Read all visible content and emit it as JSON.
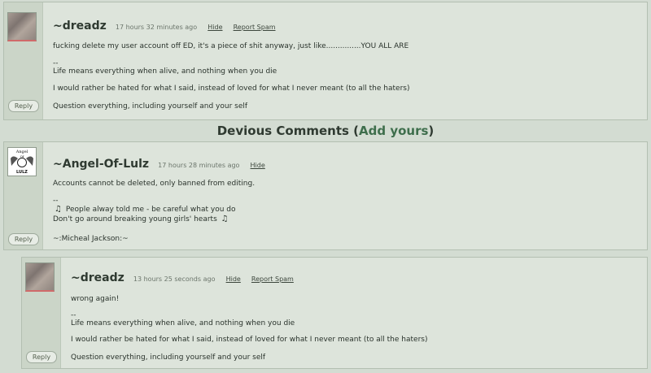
{
  "comment1": {
    "username": "~dreadz",
    "timestamp": "17 hours 32 minutes ago",
    "hide": "Hide",
    "report": "Report Spam",
    "text": "fucking delete my user account off ED, it's a piece of shit anyway, just like...............YOU ALL ARE",
    "sig_sep": "--",
    "sig_line1": "Life means everything when alive, and nothing when you die",
    "sig_line2": "I would rather be hated for what I said, instead of loved for what I never meant (to all the haters)",
    "sig_line3": "Question everything, including yourself and your self",
    "reply": "Reply"
  },
  "section": {
    "title": "Devious Comments",
    "open_paren": "(",
    "add": "Add yours",
    "close_paren": ")"
  },
  "comment2": {
    "username": "~Angel-Of-Lulz",
    "timestamp": "17 hours 28 minutes ago",
    "hide": "Hide",
    "text": "Accounts cannot be deleted, only banned from editing.",
    "sig_sep": "--",
    "sig_line1": "People alway told me - be careful what you do",
    "sig_line2": "Don't go around breaking young girls' hearts",
    "sig_line3": "~:Micheal Jackson:~",
    "note_icon": "♫",
    "avatar_top": "Angel",
    "avatar_mid": "Of",
    "avatar_bottom": "LULZ",
    "reply": "Reply"
  },
  "comment3": {
    "username": "~dreadz",
    "timestamp": "13 hours 25 seconds ago",
    "hide": "Hide",
    "report": "Report Spam",
    "text": "wrong again!",
    "sig_sep": "--",
    "sig_line1": "Life means everything when alive, and nothing when you die",
    "sig_line2": "I would rather be hated for what I said, instead of loved for what I never meant (to all the haters)",
    "sig_line3": "Question everything, including yourself and your self",
    "reply": "Reply"
  }
}
